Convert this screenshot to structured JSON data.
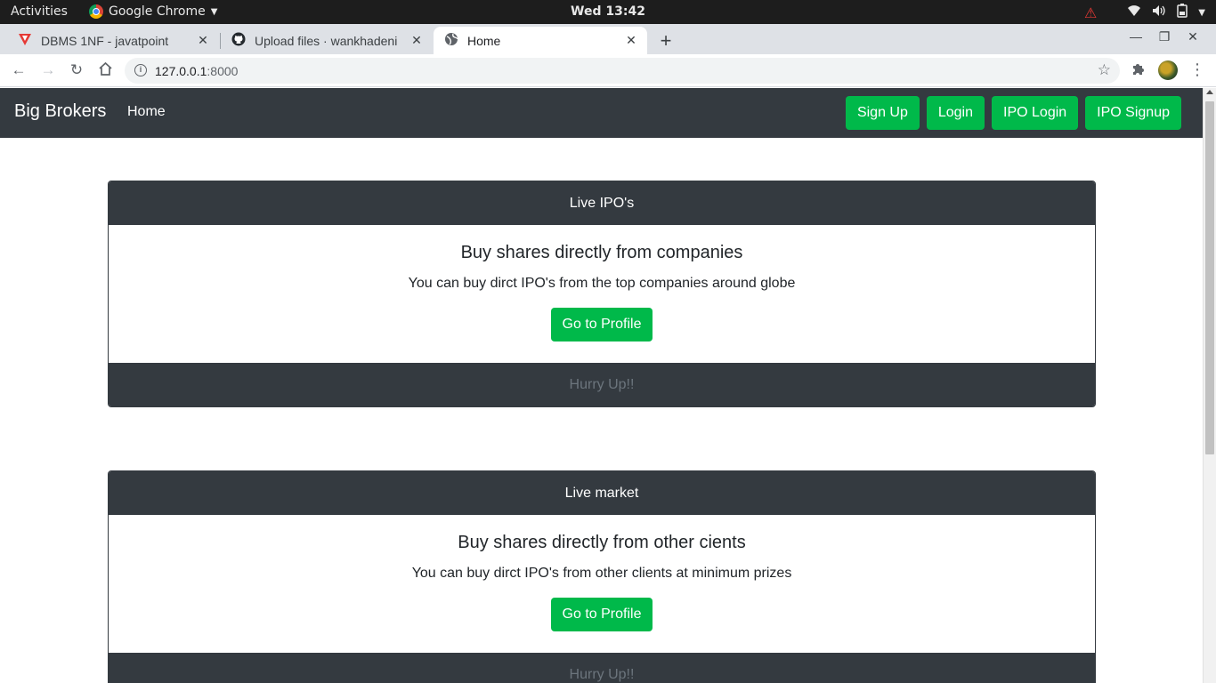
{
  "os": {
    "activities": "Activities",
    "app_name": "Google Chrome",
    "clock": "Wed 13:42",
    "tray_icons": [
      "warning-icon",
      "wifi-icon",
      "volume-icon",
      "battery-icon",
      "chevron-down-icon"
    ]
  },
  "browser": {
    "tabs": [
      {
        "title": "DBMS 1NF - javatpoint",
        "favicon": "javatpoint-icon",
        "active": false
      },
      {
        "title": "Upload files · wankhadeni",
        "favicon": "github-icon",
        "active": false
      },
      {
        "title": "Home",
        "favicon": "globe-icon",
        "active": true
      }
    ],
    "url_host": "127.0.0.1",
    "url_port": ":8000"
  },
  "page": {
    "brand": "Big Brokers",
    "nav_home": "Home",
    "nav_buttons": [
      "Sign Up",
      "Login",
      "IPO Login",
      "IPO Signup"
    ],
    "cards": [
      {
        "header": "Live IPO's",
        "title": "Buy shares directly from companies",
        "text": "You can buy dirct IPO's from the top companies around globe",
        "button": "Go to Profile",
        "footer": "Hurry Up!!"
      },
      {
        "header": "Live market",
        "title": "Buy shares directly from other cients",
        "text": "You can buy dirct IPO's from other clients at minimum prizes",
        "button": "Go to Profile",
        "footer": "Hurry Up!!"
      }
    ]
  },
  "colors": {
    "navbar": "#343a40",
    "accent_green": "#00b94a",
    "footer_text": "#6c757d"
  }
}
